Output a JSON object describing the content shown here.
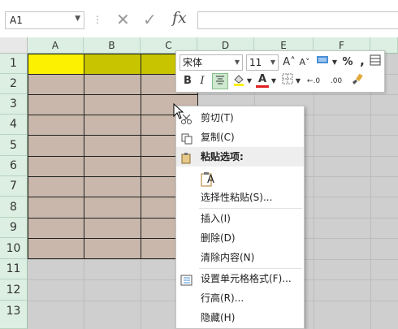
{
  "formula_bar": {
    "name_box": "A1",
    "separator": "⋮",
    "cancel_glyph": "✕",
    "enter_glyph": "✓",
    "fx_label": "fx",
    "content": ""
  },
  "columns": [
    "A",
    "B",
    "C",
    "D",
    "E",
    "F"
  ],
  "rows": [
    "1",
    "2",
    "3",
    "4",
    "5",
    "6",
    "7",
    "8",
    "9",
    "10",
    "11",
    "12",
    "13"
  ],
  "colors": {
    "header_yellow": "#fbf100",
    "header_olive": "#c8c400",
    "body_fill": "#c8b7aa",
    "grid_gray": "#cfcfcf",
    "header_green": "#dcefe2"
  },
  "mini_toolbar": {
    "font_name": "宋体",
    "font_size": "11",
    "grow_font": "A˄",
    "shrink_font": "A˅",
    "number_format_icon": "accounting-format-icon",
    "percent": "%",
    "comma": ",",
    "bold": "B",
    "italic": "I",
    "font_color": "A",
    "increase_decimal": "←.0",
    "decrease_decimal": ".00",
    "format_painter_icon": "paintbrush-icon"
  },
  "context_menu": {
    "items": [
      {
        "label": "剪切(T)",
        "icon": "scissors-icon"
      },
      {
        "label": "复制(C)",
        "icon": "copy-icon"
      },
      {
        "label": "粘贴选项:",
        "icon": "clipboard-icon"
      },
      {
        "label": "A",
        "icon": "paste-option-icon"
      },
      {
        "label": "选择性粘贴(S)..."
      },
      {
        "label": "插入(I)"
      },
      {
        "label": "删除(D)"
      },
      {
        "label": "清除内容(N)"
      },
      {
        "label": "设置单元格格式(F)...",
        "icon": "format-cells-icon"
      },
      {
        "label": "行高(R)..."
      },
      {
        "label": "隐藏(H)"
      }
    ]
  }
}
